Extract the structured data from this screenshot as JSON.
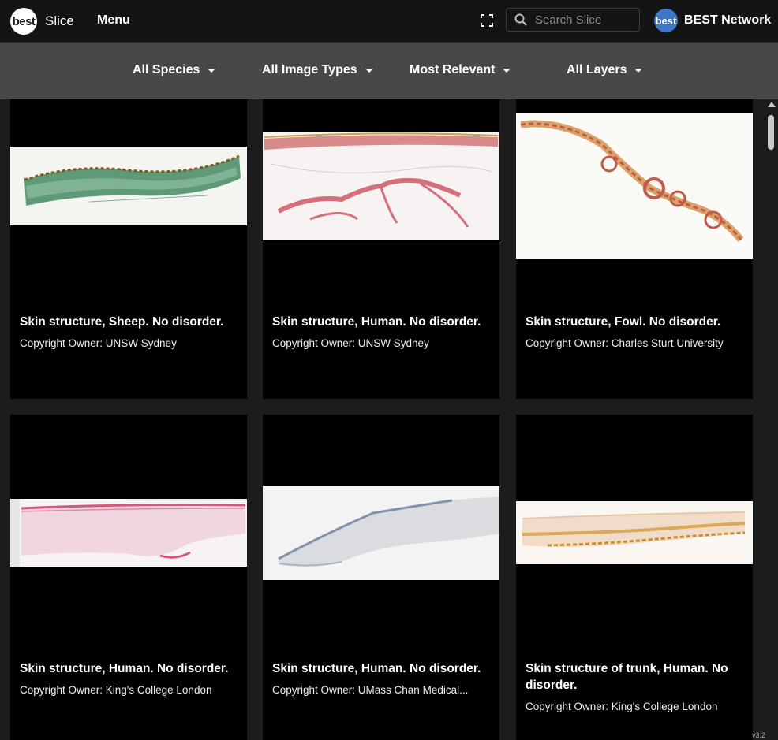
{
  "header": {
    "logo_text": "best",
    "app_name": "Slice",
    "menu_label": "Menu",
    "search_placeholder": "Search Slice",
    "network_badge_text": "best",
    "network_label": "BEST Network"
  },
  "filters": [
    {
      "label": "All Species"
    },
    {
      "label": "All Image Types"
    },
    {
      "label": "Most Relevant"
    },
    {
      "label": "All Layers"
    }
  ],
  "cards": [
    {
      "title": "Skin structure, Sheep. No disorder.",
      "owner": "Copyright Owner: UNSW Sydney",
      "stain": "green"
    },
    {
      "title": "Skin structure, Human. No disorder.",
      "owner": "Copyright Owner: UNSW Sydney",
      "stain": "pink-red"
    },
    {
      "title": "Skin structure, Fowl. No disorder.",
      "owner": "Copyright Owner: Charles Sturt University",
      "stain": "red-orange"
    },
    {
      "title": "Skin structure, Human. No disorder.",
      "owner": "Copyright Owner: King's College London",
      "stain": "pink"
    },
    {
      "title": "Skin structure, Human. No disorder.",
      "owner": "Copyright Owner: UMass Chan Medical...",
      "stain": "blue-grey"
    },
    {
      "title": "Skin structure of trunk, Human. No disorder.",
      "owner": "Copyright Owner: King's College London",
      "stain": "tan-gold"
    }
  ],
  "version": "v3.2",
  "colors": {
    "topbar": "#141414",
    "filterbar": "#484848",
    "background": "#1c1c1c",
    "card": "#000000",
    "network_badge": "#3c78c9"
  }
}
